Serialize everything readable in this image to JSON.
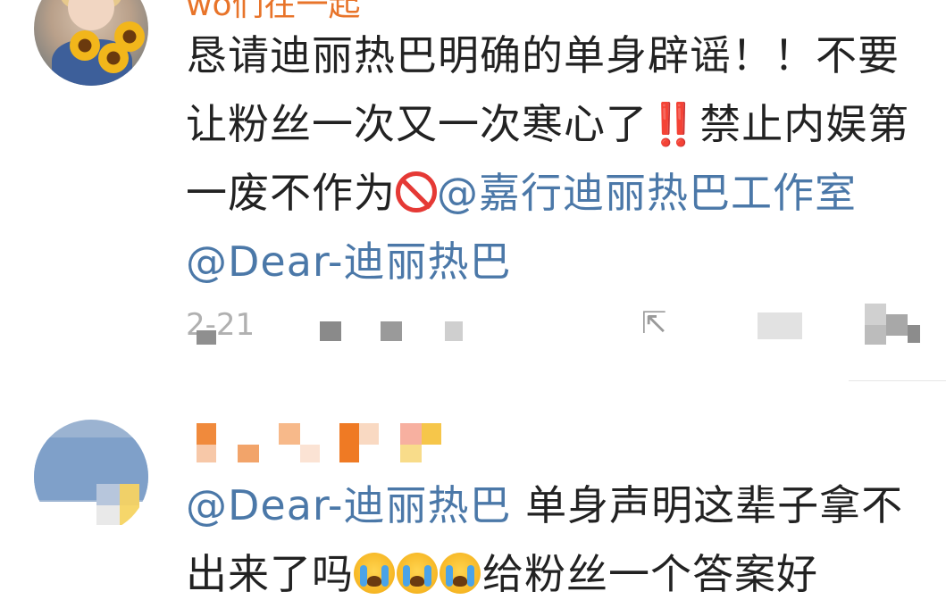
{
  "comment1": {
    "username": "wo们在一起",
    "text_part1": "恳请迪丽热巴明确的单身辟谣！！不要让粉丝一次又一次寒心了",
    "emoji_bang": "‼️",
    "text_part2": "禁止内娱第一废不作为",
    "mention1": "@嘉行迪丽热巴工作室",
    "mention2": "@Dear-迪丽热巴",
    "time": "2-21"
  },
  "comment2": {
    "mention": "@Dear-迪丽热巴",
    "text_part1": "单身声明这辈子拿不出来了吗",
    "text_part2": "给粉丝一个答案好"
  },
  "icons": {
    "share": "share-icon",
    "comment": "comment-icon",
    "like": "like-icon",
    "no_entry": "no-entry-emoji",
    "crying": "loudly-crying-face-emoji",
    "double_exclamation": "double-exclamation-emoji"
  },
  "colors": {
    "mention": "#4b78a8",
    "username": "#e8742a",
    "text": "#222222"
  }
}
